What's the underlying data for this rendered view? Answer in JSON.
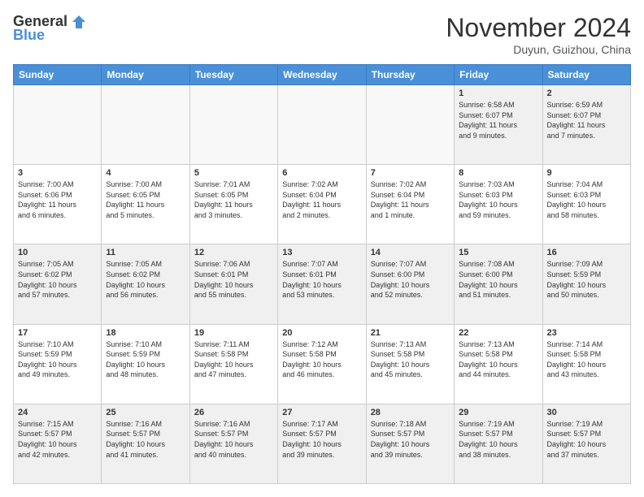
{
  "header": {
    "logo_general": "General",
    "logo_blue": "Blue",
    "month_title": "November 2024",
    "subtitle": "Duyun, Guizhou, China"
  },
  "weekdays": [
    "Sunday",
    "Monday",
    "Tuesday",
    "Wednesday",
    "Thursday",
    "Friday",
    "Saturday"
  ],
  "weeks": [
    [
      {
        "day": "",
        "info": ""
      },
      {
        "day": "",
        "info": ""
      },
      {
        "day": "",
        "info": ""
      },
      {
        "day": "",
        "info": ""
      },
      {
        "day": "",
        "info": ""
      },
      {
        "day": "1",
        "info": "Sunrise: 6:58 AM\nSunset: 6:07 PM\nDaylight: 11 hours\nand 9 minutes."
      },
      {
        "day": "2",
        "info": "Sunrise: 6:59 AM\nSunset: 6:07 PM\nDaylight: 11 hours\nand 7 minutes."
      }
    ],
    [
      {
        "day": "3",
        "info": "Sunrise: 7:00 AM\nSunset: 6:06 PM\nDaylight: 11 hours\nand 6 minutes."
      },
      {
        "day": "4",
        "info": "Sunrise: 7:00 AM\nSunset: 6:05 PM\nDaylight: 11 hours\nand 5 minutes."
      },
      {
        "day": "5",
        "info": "Sunrise: 7:01 AM\nSunset: 6:05 PM\nDaylight: 11 hours\nand 3 minutes."
      },
      {
        "day": "6",
        "info": "Sunrise: 7:02 AM\nSunset: 6:04 PM\nDaylight: 11 hours\nand 2 minutes."
      },
      {
        "day": "7",
        "info": "Sunrise: 7:02 AM\nSunset: 6:04 PM\nDaylight: 11 hours\nand 1 minute."
      },
      {
        "day": "8",
        "info": "Sunrise: 7:03 AM\nSunset: 6:03 PM\nDaylight: 10 hours\nand 59 minutes."
      },
      {
        "day": "9",
        "info": "Sunrise: 7:04 AM\nSunset: 6:03 PM\nDaylight: 10 hours\nand 58 minutes."
      }
    ],
    [
      {
        "day": "10",
        "info": "Sunrise: 7:05 AM\nSunset: 6:02 PM\nDaylight: 10 hours\nand 57 minutes."
      },
      {
        "day": "11",
        "info": "Sunrise: 7:05 AM\nSunset: 6:02 PM\nDaylight: 10 hours\nand 56 minutes."
      },
      {
        "day": "12",
        "info": "Sunrise: 7:06 AM\nSunset: 6:01 PM\nDaylight: 10 hours\nand 55 minutes."
      },
      {
        "day": "13",
        "info": "Sunrise: 7:07 AM\nSunset: 6:01 PM\nDaylight: 10 hours\nand 53 minutes."
      },
      {
        "day": "14",
        "info": "Sunrise: 7:07 AM\nSunset: 6:00 PM\nDaylight: 10 hours\nand 52 minutes."
      },
      {
        "day": "15",
        "info": "Sunrise: 7:08 AM\nSunset: 6:00 PM\nDaylight: 10 hours\nand 51 minutes."
      },
      {
        "day": "16",
        "info": "Sunrise: 7:09 AM\nSunset: 5:59 PM\nDaylight: 10 hours\nand 50 minutes."
      }
    ],
    [
      {
        "day": "17",
        "info": "Sunrise: 7:10 AM\nSunset: 5:59 PM\nDaylight: 10 hours\nand 49 minutes."
      },
      {
        "day": "18",
        "info": "Sunrise: 7:10 AM\nSunset: 5:59 PM\nDaylight: 10 hours\nand 48 minutes."
      },
      {
        "day": "19",
        "info": "Sunrise: 7:11 AM\nSunset: 5:58 PM\nDaylight: 10 hours\nand 47 minutes."
      },
      {
        "day": "20",
        "info": "Sunrise: 7:12 AM\nSunset: 5:58 PM\nDaylight: 10 hours\nand 46 minutes."
      },
      {
        "day": "21",
        "info": "Sunrise: 7:13 AM\nSunset: 5:58 PM\nDaylight: 10 hours\nand 45 minutes."
      },
      {
        "day": "22",
        "info": "Sunrise: 7:13 AM\nSunset: 5:58 PM\nDaylight: 10 hours\nand 44 minutes."
      },
      {
        "day": "23",
        "info": "Sunrise: 7:14 AM\nSunset: 5:58 PM\nDaylight: 10 hours\nand 43 minutes."
      }
    ],
    [
      {
        "day": "24",
        "info": "Sunrise: 7:15 AM\nSunset: 5:57 PM\nDaylight: 10 hours\nand 42 minutes."
      },
      {
        "day": "25",
        "info": "Sunrise: 7:16 AM\nSunset: 5:57 PM\nDaylight: 10 hours\nand 41 minutes."
      },
      {
        "day": "26",
        "info": "Sunrise: 7:16 AM\nSunset: 5:57 PM\nDaylight: 10 hours\nand 40 minutes."
      },
      {
        "day": "27",
        "info": "Sunrise: 7:17 AM\nSunset: 5:57 PM\nDaylight: 10 hours\nand 39 minutes."
      },
      {
        "day": "28",
        "info": "Sunrise: 7:18 AM\nSunset: 5:57 PM\nDaylight: 10 hours\nand 39 minutes."
      },
      {
        "day": "29",
        "info": "Sunrise: 7:19 AM\nSunset: 5:57 PM\nDaylight: 10 hours\nand 38 minutes."
      },
      {
        "day": "30",
        "info": "Sunrise: 7:19 AM\nSunset: 5:57 PM\nDaylight: 10 hours\nand 37 minutes."
      }
    ]
  ]
}
